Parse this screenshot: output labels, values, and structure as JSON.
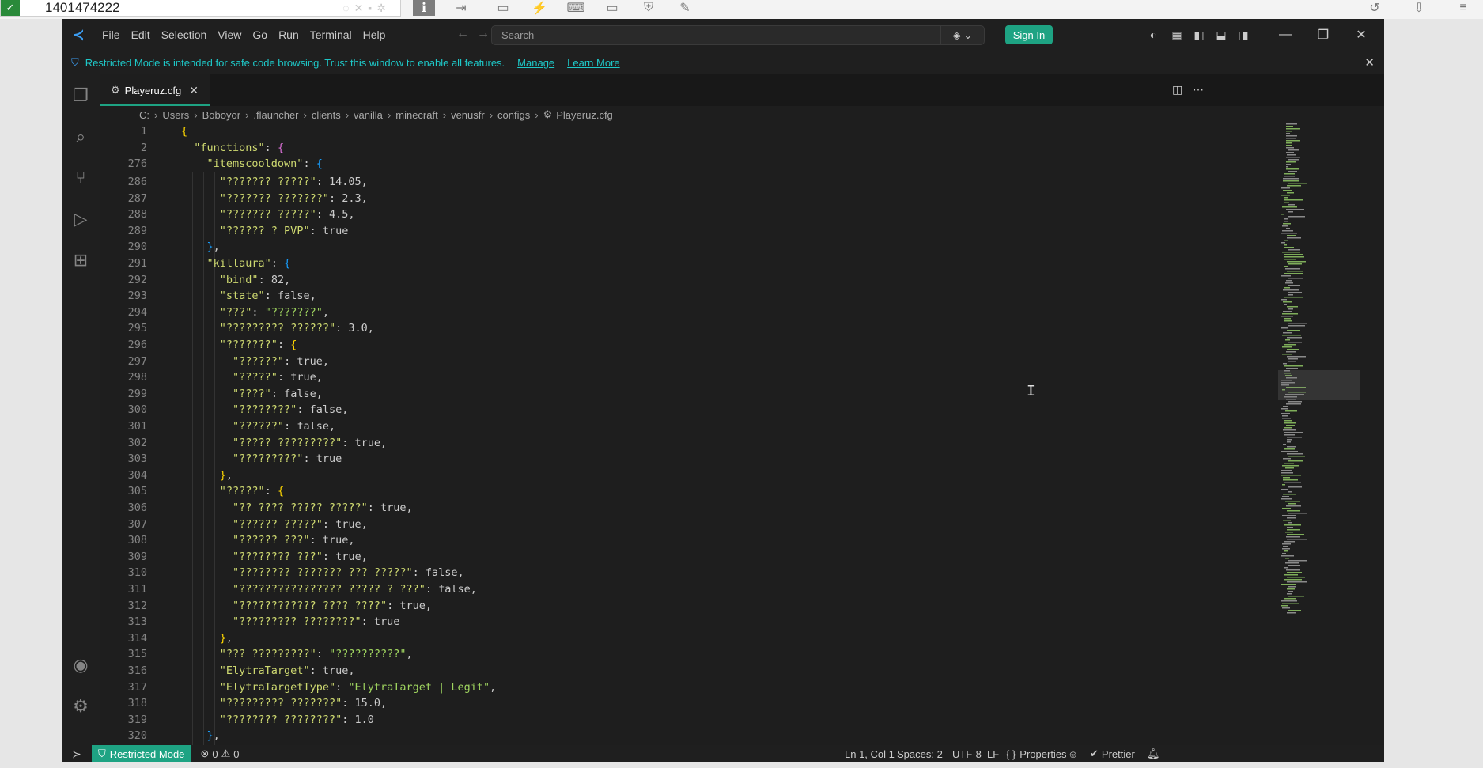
{
  "remote_toolbar": {
    "session_id": "1401474222"
  },
  "window": {
    "menu": [
      "File",
      "Edit",
      "Selection",
      "View",
      "Go",
      "Run",
      "Terminal",
      "Help"
    ],
    "search_placeholder": "Search",
    "sign_in_label": "Sign In"
  },
  "banner": {
    "message": "Restricted Mode is intended for safe code browsing. Trust this window to enable all features.",
    "manage_label": "Manage",
    "learn_more_label": "Learn More"
  },
  "tab": {
    "title": "Playeruz.cfg"
  },
  "breadcrumb": [
    "C:",
    "Users",
    "Boboyor",
    ".flauncher",
    "clients",
    "vanilla",
    "minecraft",
    "venusfr",
    "configs",
    "Playeruz.cfg"
  ],
  "status_bar": {
    "restricted_label": "Restricted Mode",
    "errors": "0",
    "warnings": "0",
    "position": "Ln 1, Col 1",
    "spaces": "Spaces: 2",
    "encoding": "UTF-8",
    "eol": "LF",
    "language": "Properties",
    "formatter": "Prettier"
  },
  "colors": {
    "accent": "#1ea383",
    "editor_bg": "#1e1e1e",
    "banner_text": "#1ec8c8"
  },
  "code_lines": [
    {
      "n": "1",
      "t": "{"
    },
    {
      "n": "2",
      "t": "  \"functions\": {"
    },
    {
      "n": "276",
      "t": "    \"itemscooldown\": {"
    },
    {
      "n": "286",
      "t": "      \"??????? ?????\": 14.05,"
    },
    {
      "n": "287",
      "t": "      \"??????? ???????\": 2.3,"
    },
    {
      "n": "288",
      "t": "      \"??????? ?????\": 4.5,"
    },
    {
      "n": "289",
      "t": "      \"?????? ? PVP\": true"
    },
    {
      "n": "290",
      "t": "    },"
    },
    {
      "n": "291",
      "t": "    \"killaura\": {"
    },
    {
      "n": "292",
      "t": "      \"bind\": 82,"
    },
    {
      "n": "293",
      "t": "      \"state\": false,"
    },
    {
      "n": "294",
      "t": "      \"???\": \"???????\","
    },
    {
      "n": "295",
      "t": "      \"????????? ??????\": 3.0,"
    },
    {
      "n": "296",
      "t": "      \"???????\": {"
    },
    {
      "n": "297",
      "t": "        \"??????\": true,"
    },
    {
      "n": "298",
      "t": "        \"?????\": true,"
    },
    {
      "n": "299",
      "t": "        \"????\": false,"
    },
    {
      "n": "300",
      "t": "        \"????????\": false,"
    },
    {
      "n": "301",
      "t": "        \"??????\": false,"
    },
    {
      "n": "302",
      "t": "        \"????? ?????????\": true,"
    },
    {
      "n": "303",
      "t": "        \"?????????\": true"
    },
    {
      "n": "304",
      "t": "      },"
    },
    {
      "n": "305",
      "t": "      \"?????\": {"
    },
    {
      "n": "306",
      "t": "        \"?? ???? ????? ?????\": true,"
    },
    {
      "n": "307",
      "t": "        \"?????? ?????\": true,"
    },
    {
      "n": "308",
      "t": "        \"?????? ???\": true,"
    },
    {
      "n": "309",
      "t": "        \"???????? ???\": true,"
    },
    {
      "n": "310",
      "t": "        \"???????? ??????? ??? ?????\": false,"
    },
    {
      "n": "311",
      "t": "        \"???????????????? ????? ? ???\": false,"
    },
    {
      "n": "312",
      "t": "        \"???????????? ???? ????\": true,"
    },
    {
      "n": "313",
      "t": "        \"????????? ????????\": true"
    },
    {
      "n": "314",
      "t": "      },"
    },
    {
      "n": "315",
      "t": "      \"??? ?????????\": \"??????????\","
    },
    {
      "n": "316",
      "t": "      \"ElytraTarget\": true,"
    },
    {
      "n": "317",
      "t": "      \"ElytraTargetType\": \"ElytraTarget | Legit\","
    },
    {
      "n": "318",
      "t": "      \"????????? ???????\": 15.0,"
    },
    {
      "n": "319",
      "t": "      \"???????? ????????\": 1.0"
    },
    {
      "n": "320",
      "t": "    },"
    }
  ]
}
